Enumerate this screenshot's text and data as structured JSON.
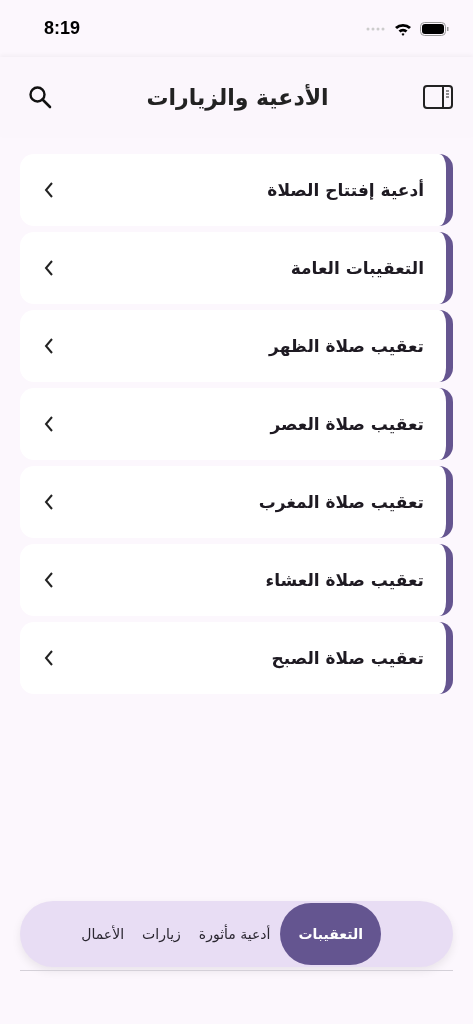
{
  "status_bar": {
    "time": "8:19"
  },
  "header": {
    "title": "الأدعية والزيارات"
  },
  "items": [
    {
      "label": "أدعية إفتتاح الصلاة"
    },
    {
      "label": "التعقيبات العامة"
    },
    {
      "label": "تعقيب صلاة الظهر"
    },
    {
      "label": "تعقيب صلاة العصر"
    },
    {
      "label": "تعقيب صلاة المغرب"
    },
    {
      "label": "تعقيب صلاة العشاء"
    },
    {
      "label": "تعقيب صلاة الصبح"
    }
  ],
  "tabs": [
    {
      "label": "التعقيبات",
      "selected": true
    },
    {
      "label": "أدعية مأثورة",
      "selected": false
    },
    {
      "label": "زيارات",
      "selected": false
    },
    {
      "label": "الأعمال",
      "selected": false
    }
  ]
}
